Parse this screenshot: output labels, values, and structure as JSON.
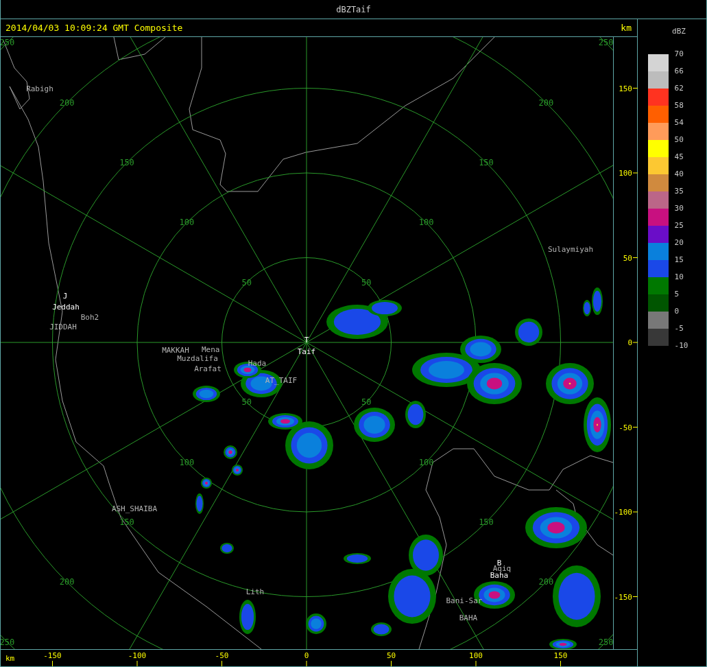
{
  "window": {
    "title": "dBZTaif"
  },
  "header": {
    "timestamp": "2014/04/03 10:09:24 GMT Composite",
    "unit": "km"
  },
  "map": {
    "rings": [
      {
        "labels": [
          "50",
          "50",
          "50",
          "50"
        ]
      },
      {
        "labels": [
          "100",
          "100",
          "100",
          "100"
        ]
      },
      {
        "labels": [
          "150",
          "150",
          "150",
          "150"
        ]
      },
      {
        "labels": [
          "200",
          "200",
          "200",
          "200"
        ]
      },
      {
        "labels": [
          "250",
          "250",
          "250",
          "250"
        ]
      }
    ],
    "places": [
      {
        "kind": "place",
        "label": "Rabigh"
      },
      {
        "kind": "station",
        "label": "J"
      },
      {
        "kind": "station",
        "label": "Jeddah"
      },
      {
        "kind": "place",
        "label": "Boh2"
      },
      {
        "kind": "place",
        "label": "JIDDAH"
      },
      {
        "kind": "station",
        "label": "T"
      },
      {
        "kind": "place",
        "label": "MAKKAH"
      },
      {
        "kind": "place",
        "label": "Mena"
      },
      {
        "kind": "station",
        "label": "Taif"
      },
      {
        "kind": "place",
        "label": "Muzdalifa"
      },
      {
        "kind": "place",
        "label": "Hada"
      },
      {
        "kind": "place",
        "label": "Arafat"
      },
      {
        "kind": "place",
        "label": "AT_TAIF"
      },
      {
        "kind": "place",
        "label": "Sulaymiyah"
      },
      {
        "kind": "place",
        "label": "ASH_SHAIBA"
      },
      {
        "kind": "place",
        "label": "Lith"
      },
      {
        "kind": "station",
        "label": "B"
      },
      {
        "kind": "place",
        "label": "Aqiq"
      },
      {
        "kind": "station",
        "label": "Baha"
      },
      {
        "kind": "place",
        "label": "Bani-Sar"
      },
      {
        "kind": "place",
        "label": "BAHA"
      }
    ]
  },
  "y_axis": {
    "ticks": [
      "150",
      "100",
      "50",
      "0",
      "-50",
      "-100",
      "-150"
    ]
  },
  "x_axis": {
    "unit": "km",
    "ticks": [
      "-150",
      "-100",
      "-50",
      "0",
      "50",
      "100",
      "150"
    ]
  },
  "legend": {
    "title": "dBZ",
    "bins": [
      {
        "color": "#d4d4d4",
        "label": "70"
      },
      {
        "color": "#bcbcbc",
        "label": "66"
      },
      {
        "color": "#ff3320",
        "label": "62"
      },
      {
        "color": "#ff5f00",
        "label": "58"
      },
      {
        "color": "#ff9b5a",
        "label": "54"
      },
      {
        "color": "#ffff00",
        "label": "50"
      },
      {
        "color": "#fcc832",
        "label": "45"
      },
      {
        "color": "#d08a3e",
        "label": "40"
      },
      {
        "color": "#bb6688",
        "label": "35"
      },
      {
        "color": "#c81080",
        "label": "30"
      },
      {
        "color": "#6a0dc8",
        "label": "25"
      },
      {
        "color": "#0a80dc",
        "label": "20"
      },
      {
        "color": "#1a48e8",
        "label": "15"
      },
      {
        "color": "#007800",
        "label": "10"
      },
      {
        "color": "#005500",
        "label": "5"
      },
      {
        "color": "#787878",
        "label": "0"
      },
      {
        "color": "#383838",
        "label": "-5"
      }
    ],
    "last_label": "-10"
  }
}
